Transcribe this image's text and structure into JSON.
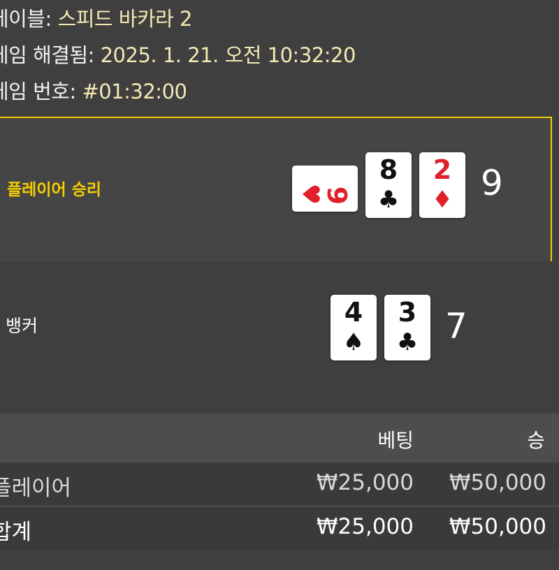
{
  "header": {
    "table_label": "테이블: ",
    "table_value": "스피드 바카라 2",
    "resolved_label": "게임 해결됨: ",
    "resolved_value": "2025. 1. 21. 오전 10:32:20",
    "game_number_label": "게임 번호: ",
    "game_number_value": "#01:32:00"
  },
  "results": {
    "player": {
      "label": "플레이어 승리",
      "total": "9",
      "cards": [
        {
          "rank": "9",
          "suit": "♥",
          "color": "#e0202a",
          "orientation": "sideways"
        },
        {
          "rank": "8",
          "suit": "♣",
          "color": "#111111",
          "orientation": "upright"
        },
        {
          "rank": "2",
          "suit": "♦",
          "color": "#e0202a",
          "orientation": "upright"
        }
      ]
    },
    "banker": {
      "label": "뱅커",
      "total": "7",
      "cards": [
        {
          "rank": "4",
          "suit": "♠",
          "color": "#111111",
          "orientation": "upright"
        },
        {
          "rank": "3",
          "suit": "♣",
          "color": "#111111",
          "orientation": "upright"
        }
      ]
    }
  },
  "bets_table": {
    "columns": [
      "베팅",
      "승"
    ],
    "rows": [
      {
        "name": "플레이어",
        "bet": "₩25,000",
        "win": "₩50,000"
      },
      {
        "name": "합계",
        "bet": "₩25,000",
        "win": "₩50,000"
      }
    ]
  },
  "colors": {
    "background": "#3f3f3f",
    "highlight_border": "#f4cd00",
    "value_text": "#f4e9b4"
  }
}
